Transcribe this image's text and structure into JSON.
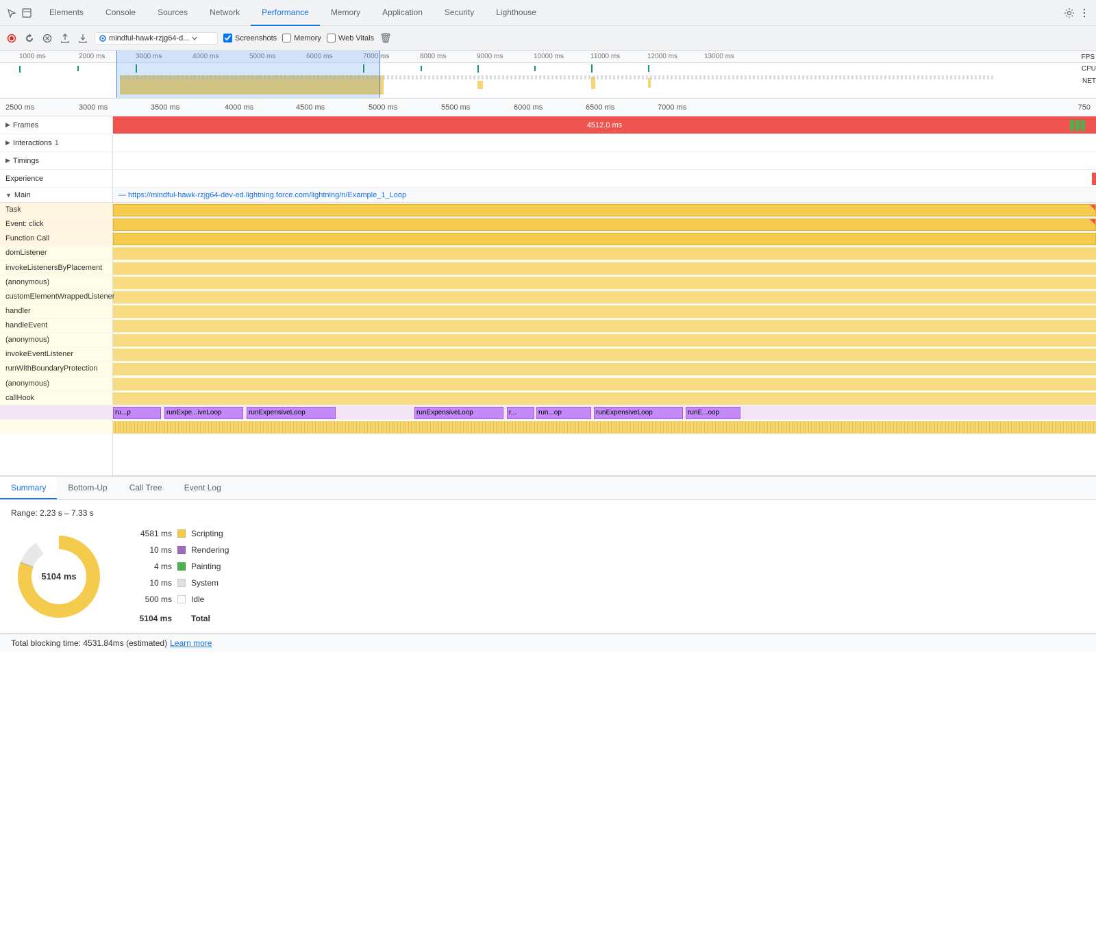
{
  "nav": {
    "tabs": [
      {
        "label": "Elements",
        "active": false
      },
      {
        "label": "Console",
        "active": false
      },
      {
        "label": "Sources",
        "active": false
      },
      {
        "label": "Network",
        "active": false
      },
      {
        "label": "Performance",
        "active": true
      },
      {
        "label": "Memory",
        "active": false
      },
      {
        "label": "Application",
        "active": false
      },
      {
        "label": "Security",
        "active": false
      },
      {
        "label": "Lighthouse",
        "active": false
      }
    ]
  },
  "toolbar": {
    "url": "mindful-hawk-rzjg64-d...",
    "screenshots_label": "Screenshots",
    "memory_label": "Memory",
    "webvitals_label": "Web Vitals"
  },
  "overview": {
    "ticks": [
      "1000 ms",
      "2000 ms",
      "3000 ms",
      "4000 ms",
      "5000 ms",
      "6000 ms",
      "7000 ms",
      "8000 ms",
      "9000 ms",
      "10000 ms",
      "11000 ms",
      "12000 ms",
      "13000 ms"
    ],
    "fps_label": "FPS",
    "cpu_label": "CPU",
    "net_label": "NET"
  },
  "timeline": {
    "ticks": [
      "2500 ms",
      "3000 ms",
      "3500 ms",
      "4000 ms",
      "4500 ms",
      "5000 ms",
      "5500 ms",
      "6000 ms",
      "6500 ms",
      "7000 ms",
      "750"
    ],
    "rows": {
      "frames_label": "Frames",
      "frames_ms": "4512.0 ms",
      "interactions_label": "Interactions",
      "interactions_count": "1",
      "timings_label": "Timings",
      "experience_label": "Experience",
      "main_label": "Main",
      "main_url": "— https://mindful-hawk-rzjg64-dev-ed.lightning.force.com/lightning/n/Example_1_Loop"
    },
    "flame": {
      "task_label": "Task",
      "event_label": "Event: click",
      "func_label": "Function Call",
      "call_stack": [
        "domListener",
        "invokeListenersByPlacement",
        "(anonymous)",
        "customElementWrappedListener",
        "handler",
        "handleEvent",
        "(anonymous)",
        "invokeEventListener",
        "runWithBoundaryProtection",
        "(anonymous)",
        "callHook"
      ],
      "purple_bars": [
        "ru...p",
        "runExpe...iveLoop",
        "runExpensiveLoop",
        "runExpensiveLoop",
        "r...",
        "run...op",
        "runExpensiveLoop",
        "runE...oop"
      ]
    }
  },
  "bottom": {
    "tabs": [
      "Summary",
      "Bottom-Up",
      "Call Tree",
      "Event Log"
    ],
    "active_tab": "Summary",
    "range": "Range: 2.23 s – 7.33 s",
    "donut_center": "5104 ms",
    "legend": [
      {
        "ms": "4581 ms",
        "color": "#f5cb4e",
        "label": "Scripting"
      },
      {
        "ms": "10 ms",
        "color": "#9c6eba",
        "label": "Rendering"
      },
      {
        "ms": "4 ms",
        "color": "#4caf50",
        "label": "Painting"
      },
      {
        "ms": "10 ms",
        "color": "#e0e0e0",
        "label": "System"
      },
      {
        "ms": "500 ms",
        "color": "#ffffff",
        "label": "Idle"
      },
      {
        "ms": "5104 ms",
        "color": null,
        "label": "Total"
      }
    ]
  },
  "status": {
    "text": "Total blocking time: 4531.84ms (estimated)",
    "link": "Learn more"
  }
}
